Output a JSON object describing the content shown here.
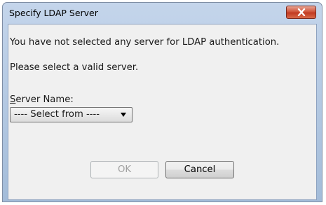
{
  "dialog": {
    "title": "Specify LDAP Server",
    "message_line1": "You have not selected any server for LDAP authentication.",
    "message_line2": "Please select a valid server.",
    "server_label_accel": "S",
    "server_label_rest": "erver Name:",
    "server_select_value": "---- Select from ----",
    "ok_label": "OK",
    "cancel_label": "Cancel",
    "ok_enabled": false
  },
  "colors": {
    "close_button": "#c23a22",
    "client_background": "#f0f0f0",
    "frame": "#a3bcd9"
  },
  "icons": {
    "close": "close-x-icon",
    "dropdown": "chevron-down-icon"
  }
}
